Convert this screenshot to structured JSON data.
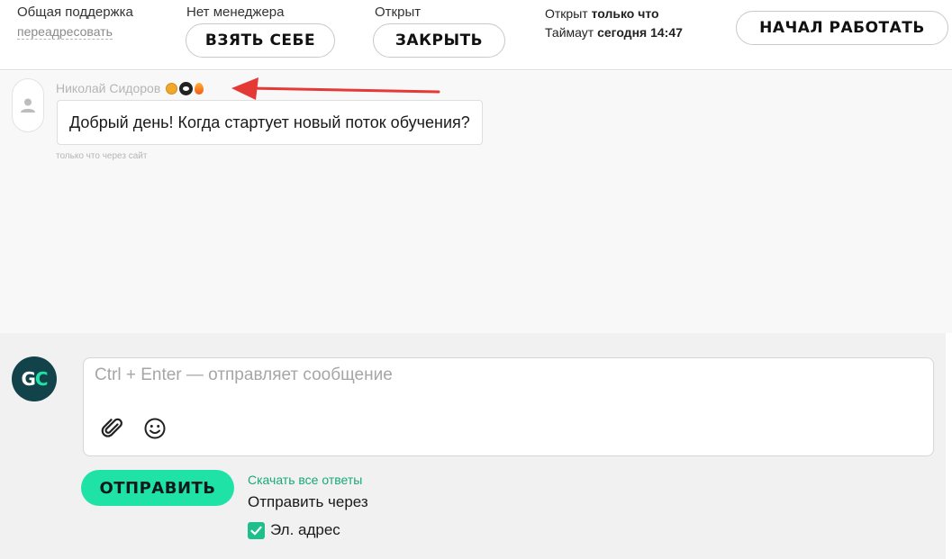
{
  "header": {
    "group": {
      "label": "Общая поддержка",
      "redirect_link": "переадресовать"
    },
    "manager": {
      "label": "Нет менеджера",
      "take_button": "ВЗЯТЬ СЕБЕ"
    },
    "state": {
      "label": "Открыт",
      "close_button": "ЗАКРЫТЬ"
    },
    "status": {
      "opened_prefix": "Открыт",
      "opened_value": "только что",
      "timeout_prefix": "Таймаут",
      "timeout_value": "сегодня 14:47"
    },
    "start_button": "НАЧАЛ РАБОТАТЬ"
  },
  "chat": {
    "message": {
      "author": "Николай Сидоров",
      "badges": [
        "hexagon-badge-icon",
        "paw-badge-icon",
        "fire-badge-icon"
      ],
      "text": "Добрый день! Когда стартует новый поток обучения?",
      "meta": "только что через сайт"
    },
    "annotation": "red-arrow-icon"
  },
  "composer": {
    "avatar": {
      "letter_g": "G",
      "letter_c": "C"
    },
    "placeholder": "Ctrl + Enter — отправляет сообщение",
    "send_button": "ОТПРАВИТЬ",
    "download_link": "Скачать все ответы",
    "send_via_label": "Отправить через",
    "channels": [
      {
        "label": "Эл. адрес",
        "checked": true
      }
    ]
  },
  "colors": {
    "accent": "#1fe3a6",
    "link_green": "#1aa878",
    "avatar_bg": "#12434a",
    "arrow_red": "#e53935"
  }
}
